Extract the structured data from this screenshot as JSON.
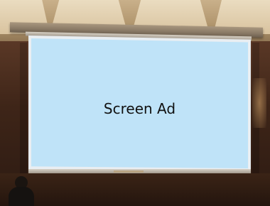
{
  "screen": {
    "text": "Screen Ad"
  },
  "colors": {
    "screen_fill": "#bfe3f8",
    "screen_frame": "#e9eef2",
    "text": "#111111",
    "wall": "#3e2518",
    "ceiling": "#c9b08a"
  }
}
